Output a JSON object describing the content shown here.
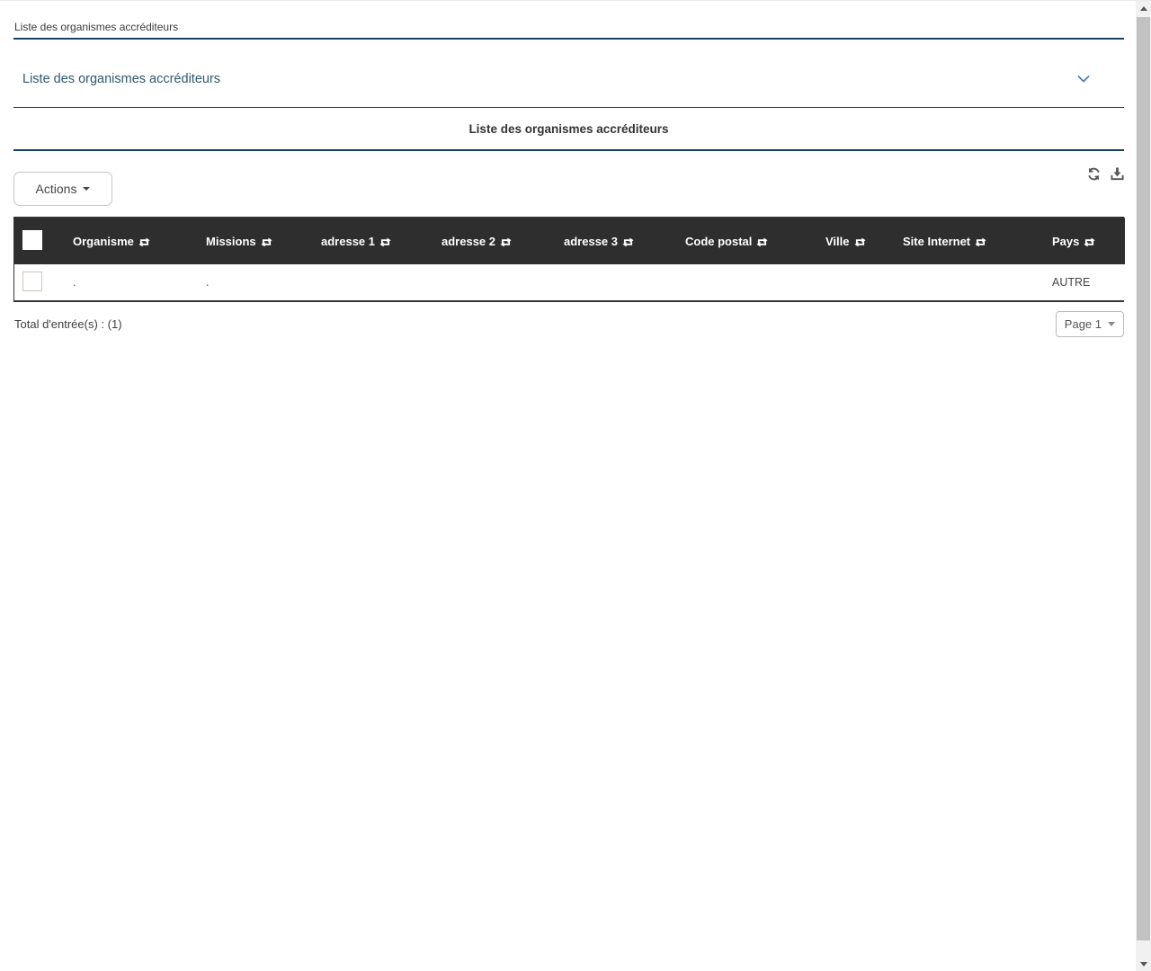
{
  "page": {
    "breadcrumb": "Liste des organismes accréditeurs"
  },
  "panel": {
    "title": "Liste des organismes accréditeurs",
    "collapse_icon": "chevron-down-icon"
  },
  "section": {
    "title": "Liste des organismes accréditeurs"
  },
  "toolbar": {
    "actions_label": "Actions",
    "actions_icon": "caret-down-icon",
    "right_icons": [
      "refresh-icon",
      "download-icon"
    ]
  },
  "table": {
    "select_all_icon": "checkbox",
    "sort_icon": "sort-arrows-icon",
    "columns": [
      {
        "key": "organisme",
        "label": "Organisme"
      },
      {
        "key": "missions",
        "label": "Missions"
      },
      {
        "key": "adresse_1",
        "label": "adresse 1"
      },
      {
        "key": "adresse_2",
        "label": "adresse 2"
      },
      {
        "key": "adresse_3",
        "label": "adresse 3"
      },
      {
        "key": "code_postal",
        "label": "Code postal"
      },
      {
        "key": "ville",
        "label": "Ville"
      },
      {
        "key": "site_internet",
        "label": "Site Internet"
      },
      {
        "key": "pays",
        "label": "Pays"
      }
    ],
    "rows": [
      {
        "organisme": ".",
        "missions": ".",
        "adresse_1": "",
        "adresse_2": "",
        "adresse_3": "",
        "code_postal": "",
        "ville": "",
        "site_internet": "",
        "pays": "AUTRE"
      }
    ]
  },
  "footer": {
    "total_label": "Total d'entrée(s) : (1)",
    "page_selector": "Page 1"
  },
  "colors": {
    "accent_line": "#1c3e63",
    "panel_title": "#2e5771",
    "table_header_bg": "#2e2e2e",
    "table_header_text": "#ffffff",
    "body_text": "#444444"
  }
}
